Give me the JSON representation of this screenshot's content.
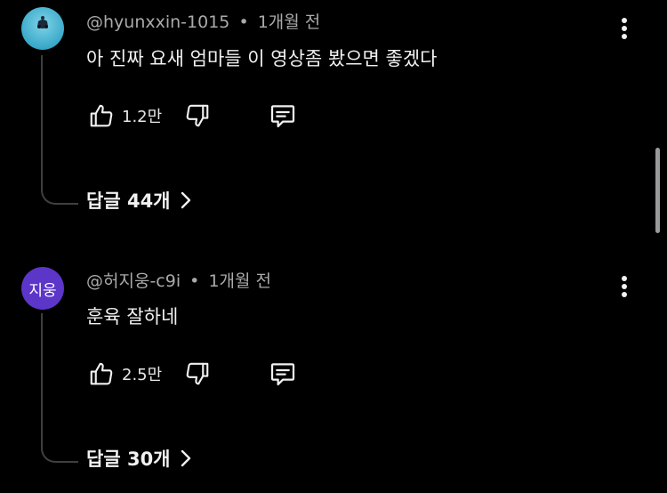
{
  "comments": [
    {
      "author": "@hyunxxin-1015",
      "time": "1개월 전",
      "text": "아 진짜 요새 엄마들 이 영상좀 봤으면 좋겠다",
      "likes": "1.2만",
      "replies_label": "답글 44개",
      "avatar_type": "photo"
    },
    {
      "author": "@허지웅-c9i",
      "time": "1개월 전",
      "text": "훈육 잘하네",
      "likes": "2.5만",
      "replies_label": "답글 30개",
      "avatar_type": "initials",
      "avatar_initials": "지웅"
    }
  ],
  "separator": "•",
  "colors": {
    "background": "#000000",
    "avatar_initials_bg": "#5c35c9",
    "meta_text": "#aaaaaa"
  },
  "icons": [
    "thumbs-up-icon",
    "thumbs-down-icon",
    "reply-icon",
    "more-vert-icon",
    "chevron-right-icon"
  ]
}
